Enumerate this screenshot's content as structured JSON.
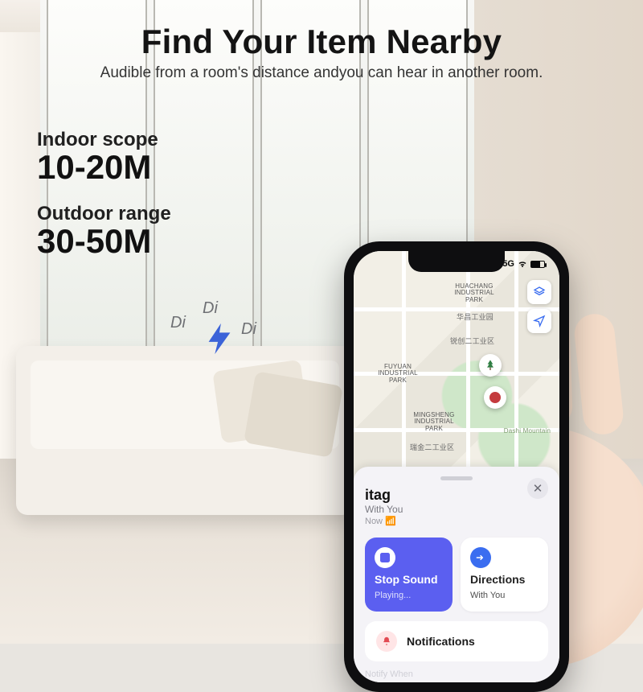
{
  "headline": {
    "title": "Find Your Item Nearby",
    "subtitle": "Audible from a room's distance andyou can hear in another room."
  },
  "specs": {
    "indoor_label": "Indoor scope",
    "indoor_value": "10-20M",
    "outdoor_label": "Outdoor range",
    "outdoor_value": "30-50M"
  },
  "sound_effect": {
    "d1": "Di",
    "d2": "Di",
    "d3": "Di"
  },
  "phone": {
    "status": {
      "time": "",
      "signal_kind": "5G"
    },
    "map": {
      "labels": {
        "huachang": "HUACHANG\nINDUSTRIAL\nPARK",
        "huachang_cn": "华昌工业园",
        "ruichuang_cn": "锐创二工业区",
        "fuyuan": "FUYUAN\nINDUSTRIAL\nPARK",
        "mingsheng": "MINGSHENG\nINDUSTRIAL\nPARK",
        "ruijin_cn": "瑞金二工业区",
        "dashi": "Dashi Mountain"
      },
      "ctrl1": "layers",
      "ctrl2": "locate"
    },
    "sheet": {
      "title": "itag",
      "subtitle": "With You",
      "time": "Now",
      "stop_title": "Stop Sound",
      "stop_sub": "Playing...",
      "directions_title": "Directions",
      "directions_sub": "With You",
      "notifications": "Notifications",
      "faint": "Notify When"
    }
  }
}
